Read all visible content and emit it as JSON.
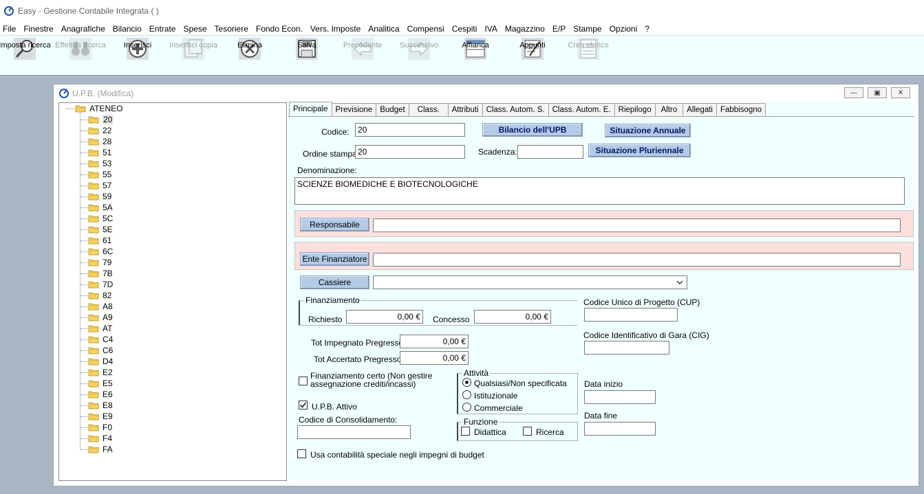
{
  "app": {
    "title": "Easy - Gestione Contabile Integrata ( )"
  },
  "menu": [
    "File",
    "Finestre",
    "Anagrafiche",
    "Bilancio",
    "Entrate",
    "Spese",
    "Tesoriere",
    "Fondo Econ.",
    "Vers. Imposte",
    "Analitica",
    "Compensi",
    "Cespiti",
    "IVA",
    "Magazzino",
    "E/P",
    "Stampe",
    "Opzioni",
    "?"
  ],
  "toolbar": {
    "imposta_ricerca": "Imposta ricerca",
    "effettua_ricerca": "Effettua ricerca",
    "inserisci": "Inserisci",
    "inserisci_copia": "Inserisci copia",
    "elimina": "Elimina",
    "salva": "Salva",
    "precedente": "Precedente",
    "successivo": "Successivo",
    "affianca": "Affianca",
    "appunti": "Appunti",
    "crea_elenco": "Crea elenco"
  },
  "window": {
    "title": "U.P.B. (Modifica)"
  },
  "tree": {
    "root": "ATENEO",
    "items": [
      "20",
      "22",
      "28",
      "51",
      "53",
      "55",
      "57",
      "59",
      "5A",
      "5C",
      "5E",
      "61",
      "6C",
      "79",
      "7B",
      "7D",
      "82",
      "A8",
      "A9",
      "AT",
      "C4",
      "C6",
      "D4",
      "E2",
      "E5",
      "E6",
      "E8",
      "E9",
      "F0",
      "F4",
      "FA"
    ]
  },
  "tabs": [
    "Principale",
    "Previsione",
    "Budget",
    "Class.",
    "Attributi",
    "Class. Autom. S.",
    "Class. Autom. E.",
    "Riepilogo",
    "Altro",
    "Allegati",
    "Fabbisogno"
  ],
  "form": {
    "codice_label": "Codice:",
    "codice_value": "20",
    "ordine_label": "Ordine stampa:",
    "ordine_value": "20",
    "scadenza_label": "Scadenza:",
    "scadenza_value": "",
    "bilancio_btn": "Bilancio dell'UPB",
    "sit_annuale_btn": "Situazione Annuale",
    "sit_pluriennale_btn": "Situazione Pluriennale",
    "denominazione_label": "Denominazione:",
    "denominazione_value": "SCIENZE BIOMEDICHE E BIOTECNOLOGICHE",
    "responsabile_btn": "Responsabile",
    "responsabile_value": "",
    "ente_btn": "Ente Finanziatore",
    "ente_value": "",
    "cassiere_btn": "Cassiere",
    "cassiere_value": "",
    "finanziamento_title": "Finanziamento",
    "richiesto_label": "Richiesto",
    "richiesto_value": "0,00 €",
    "concesso_label": "Concesso",
    "concesso_value": "0,00 €",
    "cup_label": "Codice Unico di Progetto (CUP)",
    "cup_value": "",
    "cig_label": "Codice Identificativo di Gara (CIG)",
    "cig_value": "",
    "tot_impegnato_label": "Tot Impegnato Pregresso",
    "tot_impegnato_value": "0,00 €",
    "tot_accertato_label": "Tot Accertato Pregresso",
    "tot_accertato_value": "0,00 €",
    "fin_certo_label": "Finanziamento certo (Non gestire assegnazione crediti/incassi)",
    "fin_certo_checked": false,
    "upb_attivo_label": "U.P.B. Attivo",
    "upb_attivo_checked": true,
    "consolidamento_label": "Codice di Consolidamento:",
    "consolidamento_value": "",
    "attivita_title": "Attività",
    "attivita_options": [
      "Qualsiasi/Non specificata",
      "Istituzionale",
      "Commerciale"
    ],
    "attivita_selected": "Qualsiasi/Non specificata",
    "funzione_title": "Funzione",
    "didattica_label": "Didattica",
    "ricerca_label": "Ricerca",
    "data_inizio_label": "Data inizio",
    "data_inizio_value": "",
    "data_fine_label": "Data fine",
    "data_fine_value": "",
    "contabilita_label": "Usa contabilità speciale negli impegni di budget"
  }
}
